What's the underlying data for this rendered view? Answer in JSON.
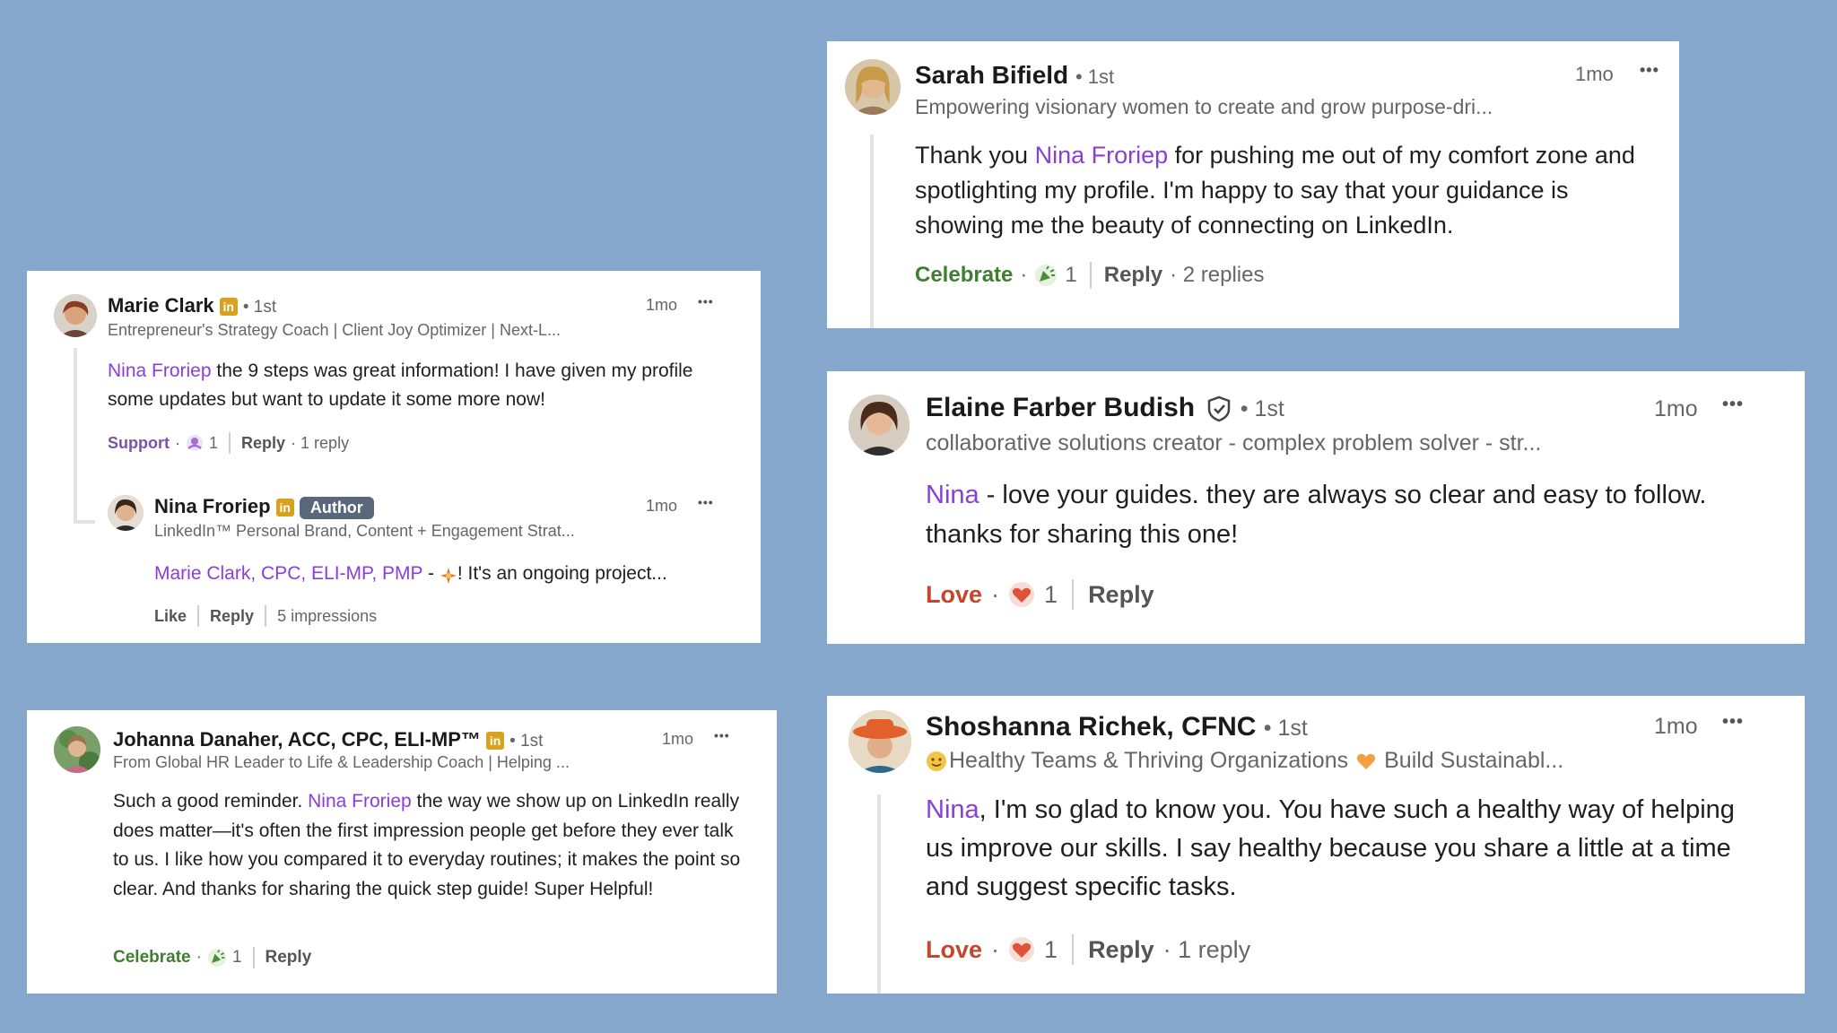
{
  "colors": {
    "background": "#84a7cb",
    "mention": "#8a3ed8",
    "celebrate": "#3f7e32",
    "support": "#7b53a8",
    "love": "#c4472b",
    "linkedin_badge": "#d9a21e",
    "author_badge": "#58677a"
  },
  "sarah": {
    "name": "Sarah Bifield",
    "degree": "• 1st",
    "headline": "Empowering visionary women to create and grow purpose-dri...",
    "time": "1mo",
    "more": "•••",
    "text_pre": "Thank you ",
    "mention": "Nina Froriep",
    "text_post": " for pushing me out of my comfort zone and spotlighting my profile. I'm happy to say that your guidance is showing me the beauty of connecting on LinkedIn.",
    "reaction": "Celebrate",
    "reaction_icon": "celebrate-icon",
    "reaction_count": "1",
    "reply": "Reply",
    "replies": "· 2 replies"
  },
  "marie": {
    "name": "Marie Clark",
    "badge": "in",
    "degree": "• 1st",
    "headline": "Entrepreneur's Strategy Coach | Client Joy Optimizer | Next-L...",
    "time": "1mo",
    "more": "•••",
    "mention": "Nina Froriep",
    "text_post": " the 9 steps was great information! I have given my profile some updates but want to update it some more now!",
    "reaction": "Support",
    "reaction_icon": "support-icon",
    "reaction_count": "1",
    "reply": "Reply",
    "replies": "· 1 reply"
  },
  "nina": {
    "name": "Nina Froriep",
    "badge": "in",
    "author": "Author",
    "headline": "LinkedIn™ Personal Brand, Content + Engagement Strat...",
    "time": "1mo",
    "more": "•••",
    "mention": "Marie Clark, CPC, ELI-MP, PMP",
    "text_post": "! It's an ongoing project...",
    "dash": " - ",
    "emoji_icon": "sparkle-icon",
    "like": "Like",
    "reply": "Reply",
    "impressions": "5 impressions"
  },
  "elaine": {
    "name": "Elaine Farber Budish",
    "verified_icon": "verified-shield-icon",
    "degree": "• 1st",
    "headline": "collaborative solutions creator - complex problem solver - str...",
    "time": "1mo",
    "more": "•••",
    "mention": "Nina",
    "text_post": " - love your guides. they are always so clear and easy to follow. thanks for sharing this one!",
    "reaction": "Love",
    "reaction_icon": "heart-icon",
    "reaction_count": "1",
    "reply": "Reply"
  },
  "johanna": {
    "name": "Johanna Danaher, ACC, CPC, ELI-MP™",
    "badge": "in",
    "degree": "• 1st",
    "headline": "From Global HR Leader to Life & Leadership Coach | Helping ...",
    "time": "1mo",
    "more": "•••",
    "text_pre": "Such a good reminder. ",
    "mention": "Nina Froriep",
    "text_post": " the way we show up on LinkedIn really does matter—it's often the first impression people get before they ever talk to us. I like how you compared it to everyday routines; it makes the point so clear. And thanks for sharing the quick step guide! Super Helpful!",
    "reaction": "Celebrate",
    "reaction_icon": "celebrate-icon",
    "reaction_count": "1",
    "reply": "Reply"
  },
  "shoshanna": {
    "name": "Shoshanna Richek, CFNC",
    "degree": "• 1st",
    "headline_icon": "smiling-face-icon",
    "headline": "Healthy Teams & Thriving Organizations",
    "headline_heart_icon": "orange-heart-icon",
    "headline_post": "Build Sustainabl...",
    "time": "1mo",
    "more": "•••",
    "mention": "Nina",
    "text_post": ", I'm so glad to know you. You have such a healthy way of helping us improve our skills. I say healthy because you share a little at a time and suggest specific tasks.",
    "reaction": "Love",
    "reaction_icon": "heart-icon",
    "reaction_count": "1",
    "reply": "Reply",
    "replies": "· 1 reply"
  }
}
